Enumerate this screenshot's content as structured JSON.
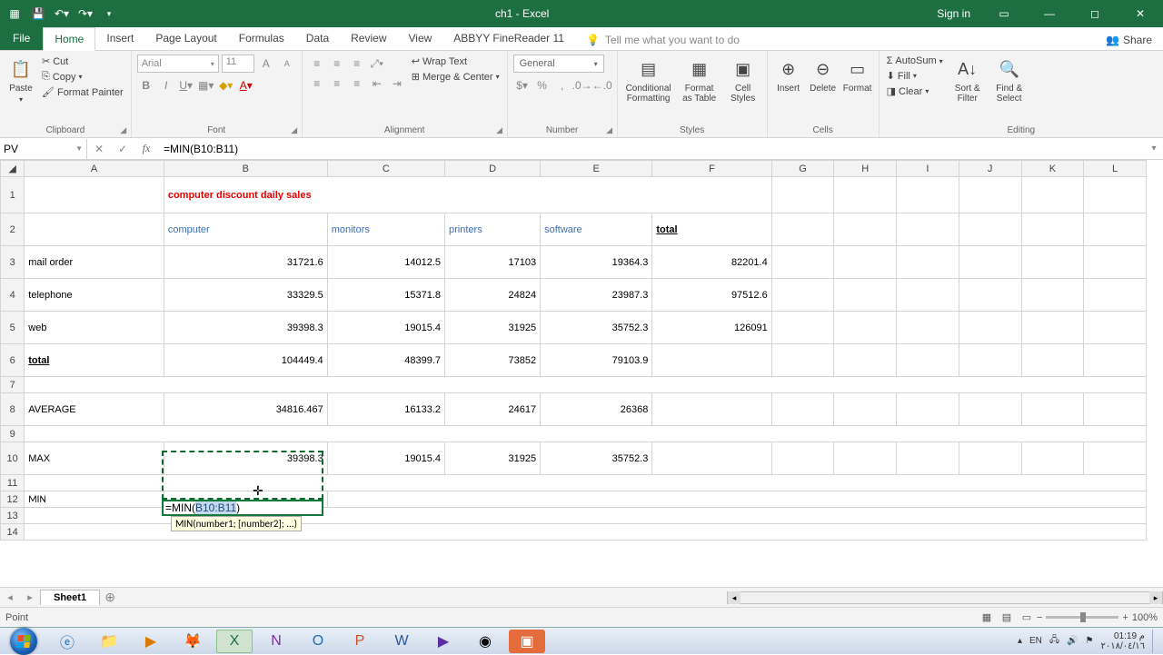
{
  "titlebar": {
    "title": "ch1 - Excel",
    "signin": "Sign in"
  },
  "tabs": {
    "file": "File",
    "items": [
      "Home",
      "Insert",
      "Page Layout",
      "Formulas",
      "Data",
      "Review",
      "View",
      "ABBYY FineReader 11"
    ],
    "active": 0,
    "tell": "Tell me what you want to do",
    "share": "Share"
  },
  "ribbon": {
    "clipboard": {
      "paste": "Paste",
      "cut": "Cut",
      "copy": "Copy",
      "fp": "Format Painter",
      "label": "Clipboard"
    },
    "font": {
      "name": "Arial",
      "size": "11",
      "label": "Font"
    },
    "alignment": {
      "wrap": "Wrap Text",
      "merge": "Merge & Center",
      "label": "Alignment"
    },
    "number": {
      "fmt": "General",
      "label": "Number"
    },
    "styles": {
      "cf": "Conditional Formatting",
      "fat": "Format as Table",
      "cs": "Cell Styles",
      "label": "Styles"
    },
    "cells": {
      "ins": "Insert",
      "del": "Delete",
      "fmt": "Format",
      "label": "Cells"
    },
    "editing": {
      "sum": "AutoSum",
      "fill": "Fill",
      "clear": "Clear",
      "sort": "Sort & Filter",
      "find": "Find & Select",
      "label": "Editing"
    }
  },
  "fbar": {
    "name": "PV",
    "formula": "=MIN(B10:B11)"
  },
  "cols": [
    "A",
    "B",
    "C",
    "D",
    "E",
    "F",
    "G",
    "H",
    "I",
    "J",
    "K",
    "L"
  ],
  "sheet": {
    "title": "computer discount daily sales",
    "headers": [
      "computer",
      "monitors",
      "printers",
      "software",
      "total"
    ],
    "rows": [
      {
        "label": "mail order",
        "v": [
          "31721.6",
          "14012.5",
          "17103",
          "19364.3",
          "82201.4"
        ]
      },
      {
        "label": "telephone",
        "v": [
          "33329.5",
          "15371.8",
          "24824",
          "23987.3",
          "97512.6"
        ]
      },
      {
        "label": "web",
        "v": [
          "39398.3",
          "19015.4",
          "31925",
          "35752.3",
          "126091"
        ]
      }
    ],
    "total_label": "total",
    "totals": [
      "104449.4",
      "48399.7",
      "73852",
      "79103.9",
      ""
    ],
    "avg_label": "AVERAGE",
    "avg": [
      "34816.467",
      "16133.2",
      "24617",
      "26368",
      ""
    ],
    "max_label": "MAX",
    "max": [
      "39398.3",
      "19015.4",
      "31925",
      "35752.3",
      ""
    ],
    "min_label": "MIN",
    "edit_text": "=MIN(B10:B11)",
    "tooltip": "MIN(number1; [number2]; ...)"
  },
  "sheettab": "Sheet1",
  "status": {
    "mode": "Point",
    "zoom": "100%"
  },
  "tray": {
    "lang": "EN",
    "time": "01:19 م",
    "date": "٢٠١٨/٠٤/١٦"
  },
  "chart_data": {
    "type": "table",
    "title": "computer discount daily sales",
    "columns": [
      "",
      "computer",
      "monitors",
      "printers",
      "software",
      "total"
    ],
    "rows": [
      [
        "mail order",
        31721.6,
        14012.5,
        17103,
        19364.3,
        82201.4
      ],
      [
        "telephone",
        33329.5,
        15371.8,
        24824,
        23987.3,
        97512.6
      ],
      [
        "web",
        39398.3,
        19015.4,
        31925,
        35752.3,
        126091
      ],
      [
        "total",
        104449.4,
        48399.7,
        73852,
        79103.9,
        null
      ],
      [
        "AVERAGE",
        34816.467,
        16133.2,
        24617,
        26368,
        null
      ],
      [
        "MAX",
        39398.3,
        19015.4,
        31925,
        35752.3,
        null
      ]
    ]
  }
}
